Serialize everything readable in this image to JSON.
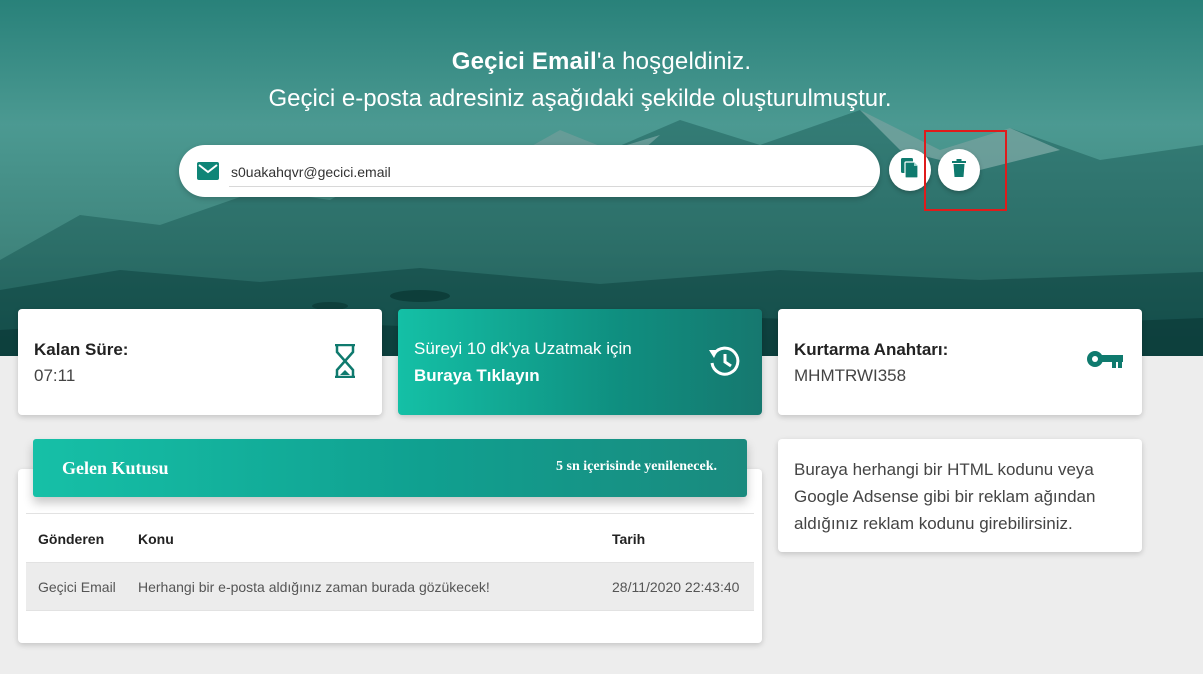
{
  "hero": {
    "title_bold": "Geçici Email",
    "title_rest": "'a hoşgeldiniz.",
    "subtitle": "Geçici e-posta adresiniz aşağıdaki şekilde oluşturulmuştur."
  },
  "email": {
    "address": "s0uakahqvr@gecici.email",
    "icon": "envelope-icon"
  },
  "actions": {
    "copy_icon": "copy-icon",
    "delete_icon": "trash-icon"
  },
  "cards": {
    "time": {
      "label": "Kalan Süre:",
      "value": "07:11",
      "icon": "hourglass-icon"
    },
    "extend": {
      "line1": "Süreyi 10 dk'ya Uzatmak için",
      "line2": "Buraya Tıklayın",
      "icon": "history-icon"
    },
    "key": {
      "label": "Kurtarma Anahtarı:",
      "value": "MHMTRWI358",
      "icon": "key-icon"
    }
  },
  "inbox": {
    "title": "Gelen Kutusu",
    "refresh_text": "5 sn içerisinde yenilenecek.",
    "columns": [
      "Gönderen",
      "Konu",
      "Tarih"
    ],
    "rows": [
      {
        "sender": "Geçici Email",
        "subject": "Herhangi bir e-posta aldığınız zaman burada gözükecek!",
        "date": "28/11/2020 22:43:40"
      }
    ]
  },
  "ad": {
    "text": "Buraya herhangi bir HTML kodunu veya Google Adsense gibi bir reklam ağından aldığınız reklam kodunu girebilirsiniz."
  },
  "colors": {
    "accent": "#0f8f80",
    "accent_light": "#14c0a6",
    "highlight": "#e01b1b"
  }
}
